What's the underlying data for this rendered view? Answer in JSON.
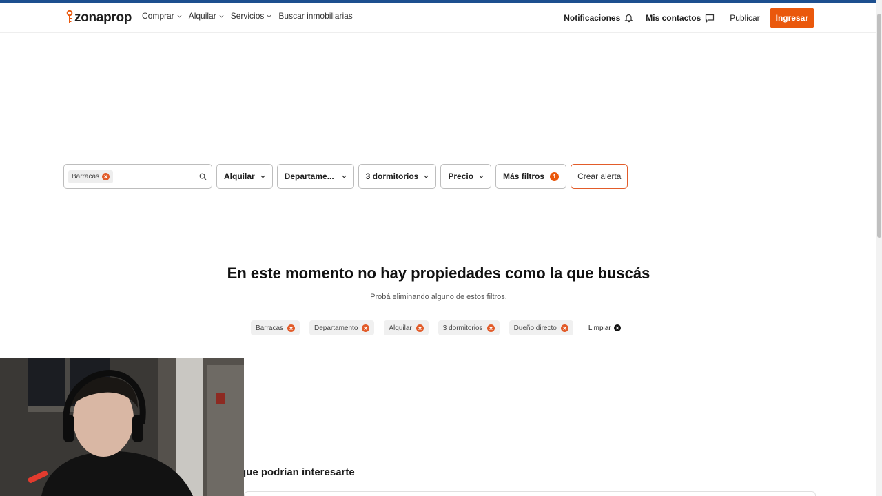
{
  "header": {
    "logo_text": "zonaprop",
    "nav": [
      {
        "label": "Comprar",
        "dropdown": true
      },
      {
        "label": "Alquilar",
        "dropdown": true
      },
      {
        "label": "Servicios",
        "dropdown": true
      },
      {
        "label": "Buscar inmobiliarias",
        "dropdown": false
      }
    ],
    "notifications_label": "Notificaciones",
    "contacts_label": "Mis contactos",
    "publish_label": "Publicar",
    "login_label": "Ingresar"
  },
  "search": {
    "location_chip": "Barracas"
  },
  "filters": {
    "operation": "Alquilar",
    "property_type": "Departame...",
    "bedrooms": "3 dormitorios",
    "price": "Precio",
    "more_filters": "Más filtros",
    "more_filters_count": "1",
    "create_alert": "Crear alerta"
  },
  "empty_state": {
    "title": "En este momento no hay propiedades como la que buscás",
    "subtitle": "Probá eliminando alguno de estos filtros.",
    "chips": [
      "Barracas",
      "Departamento",
      "Alquilar",
      "3 dormitorios",
      "Dueño directo"
    ],
    "clear_label": "Limpiar"
  },
  "recommendations": {
    "title": "que podrían interesarte"
  },
  "colors": {
    "accent": "#ea580c",
    "top_stripe": "#1d4f8f",
    "chip_x": "#e25c2a"
  }
}
